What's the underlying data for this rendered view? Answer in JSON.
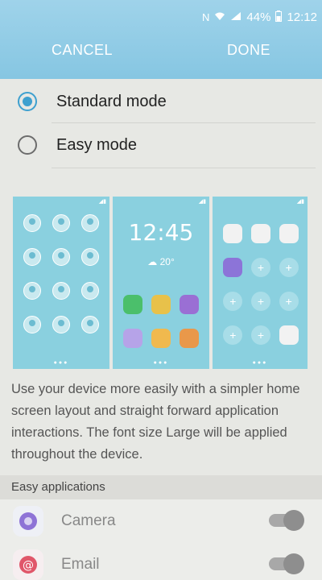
{
  "status_bar": {
    "nfc_icon": "N",
    "battery": "44%",
    "time": "12:12"
  },
  "header": {
    "cancel_label": "CANCEL",
    "done_label": "DONE"
  },
  "modes": [
    {
      "label": "Standard mode",
      "selected": true
    },
    {
      "label": "Easy mode",
      "selected": false
    }
  ],
  "preview": {
    "clock": "12:45",
    "weather": "20°"
  },
  "description": "Use your device more easily with a simpler home screen layout and straight forward application interactions. The font size Large will be applied throughout the device.",
  "easy_apps": {
    "header": "Easy applications",
    "items": [
      {
        "name": "Camera",
        "icon": "camera-icon",
        "enabled": true,
        "color": "#8e73d6"
      },
      {
        "name": "Email",
        "icon": "email-icon",
        "enabled": true,
        "color": "#e0566a"
      }
    ]
  },
  "colors": {
    "app_bar": "#8fcbe5",
    "accent": "#3ea0cf",
    "preview_bg": "#8ad0df"
  }
}
